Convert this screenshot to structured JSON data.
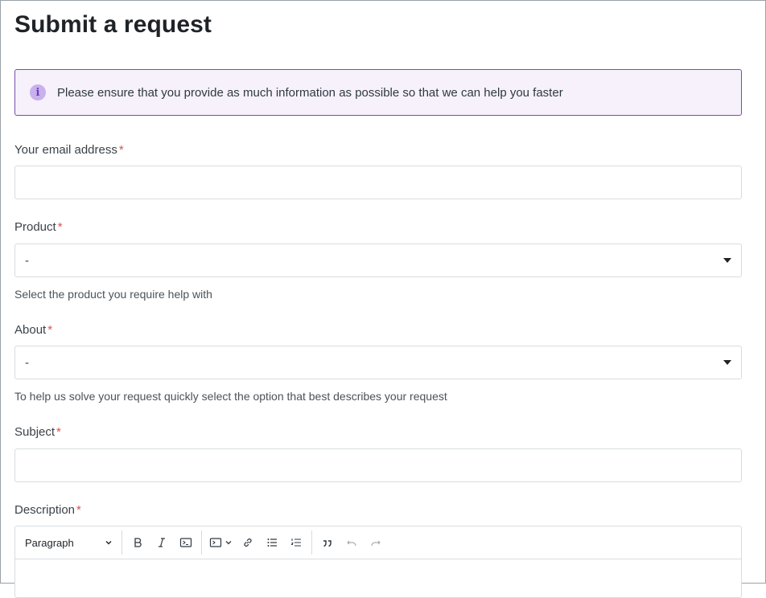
{
  "page": {
    "title": "Submit a request"
  },
  "notice": {
    "icon": "info-icon",
    "text": "Please ensure that you provide as much information as possible so that we can help you faster"
  },
  "form": {
    "required_marker": "*",
    "email": {
      "label": "Your email address",
      "value": ""
    },
    "product": {
      "label": "Product",
      "selected": "-",
      "hint": "Select the product you require help with"
    },
    "about": {
      "label": "About",
      "selected": "-",
      "hint": "To help us solve your request quickly select the option that best describes your request"
    },
    "subject": {
      "label": "Subject",
      "value": ""
    },
    "description": {
      "label": "Description",
      "toolbar": {
        "block_format": "Paragraph",
        "buttons": [
          "bold-icon",
          "italic-icon",
          "code-icon",
          "code-block-icon",
          "link-icon",
          "bulleted-list-icon",
          "numbered-list-icon",
          "quote-icon",
          "undo-icon",
          "redo-icon"
        ]
      }
    }
  }
}
